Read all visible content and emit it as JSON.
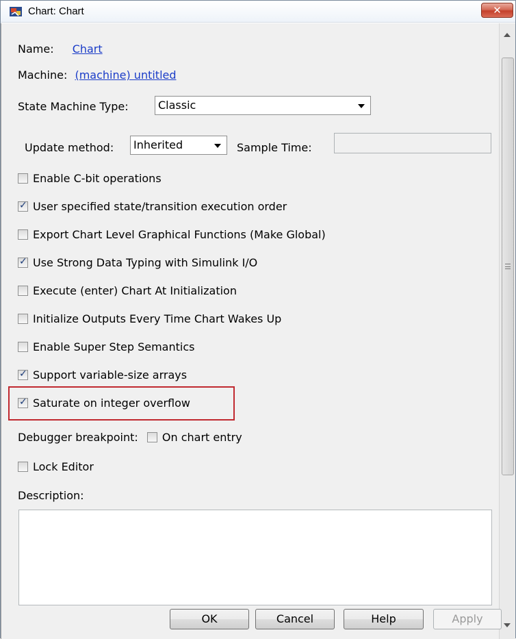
{
  "window": {
    "title": "Chart: Chart",
    "close_label": "✕"
  },
  "fields": {
    "name_label": "Name:",
    "name_value": "Chart",
    "machine_label": "Machine:",
    "machine_value": "(machine) untitled",
    "state_machine_type_label": "State Machine Type:",
    "state_machine_type_value": "Classic",
    "update_method_label": "Update method:",
    "update_method_value": "Inherited",
    "sample_time_label": "Sample Time:",
    "sample_time_value": ""
  },
  "options": [
    {
      "label": "Enable C-bit operations",
      "checked": false
    },
    {
      "label": "User specified state/transition execution order",
      "checked": true
    },
    {
      "label": "Export Chart Level Graphical Functions (Make Global)",
      "checked": false
    },
    {
      "label": "Use Strong Data Typing with Simulink I/O",
      "checked": true
    },
    {
      "label": "Execute (enter) Chart At Initialization",
      "checked": false
    },
    {
      "label": "Initialize Outputs Every Time Chart Wakes Up",
      "checked": false
    },
    {
      "label": "Enable Super Step Semantics",
      "checked": false
    },
    {
      "label": "Support variable-size arrays",
      "checked": true
    },
    {
      "label": "Saturate on integer overflow",
      "checked": true
    }
  ],
  "debugger": {
    "label": "Debugger breakpoint:",
    "option_label": "On chart entry",
    "checked": false
  },
  "lock_editor": {
    "label": "Lock Editor",
    "checked": false
  },
  "description": {
    "label": "Description:",
    "value": ""
  },
  "buttons": {
    "ok": "OK",
    "cancel": "Cancel",
    "help": "Help",
    "apply": "Apply"
  },
  "colors": {
    "highlight": "#c0282f",
    "link": "#1a3cc8"
  }
}
